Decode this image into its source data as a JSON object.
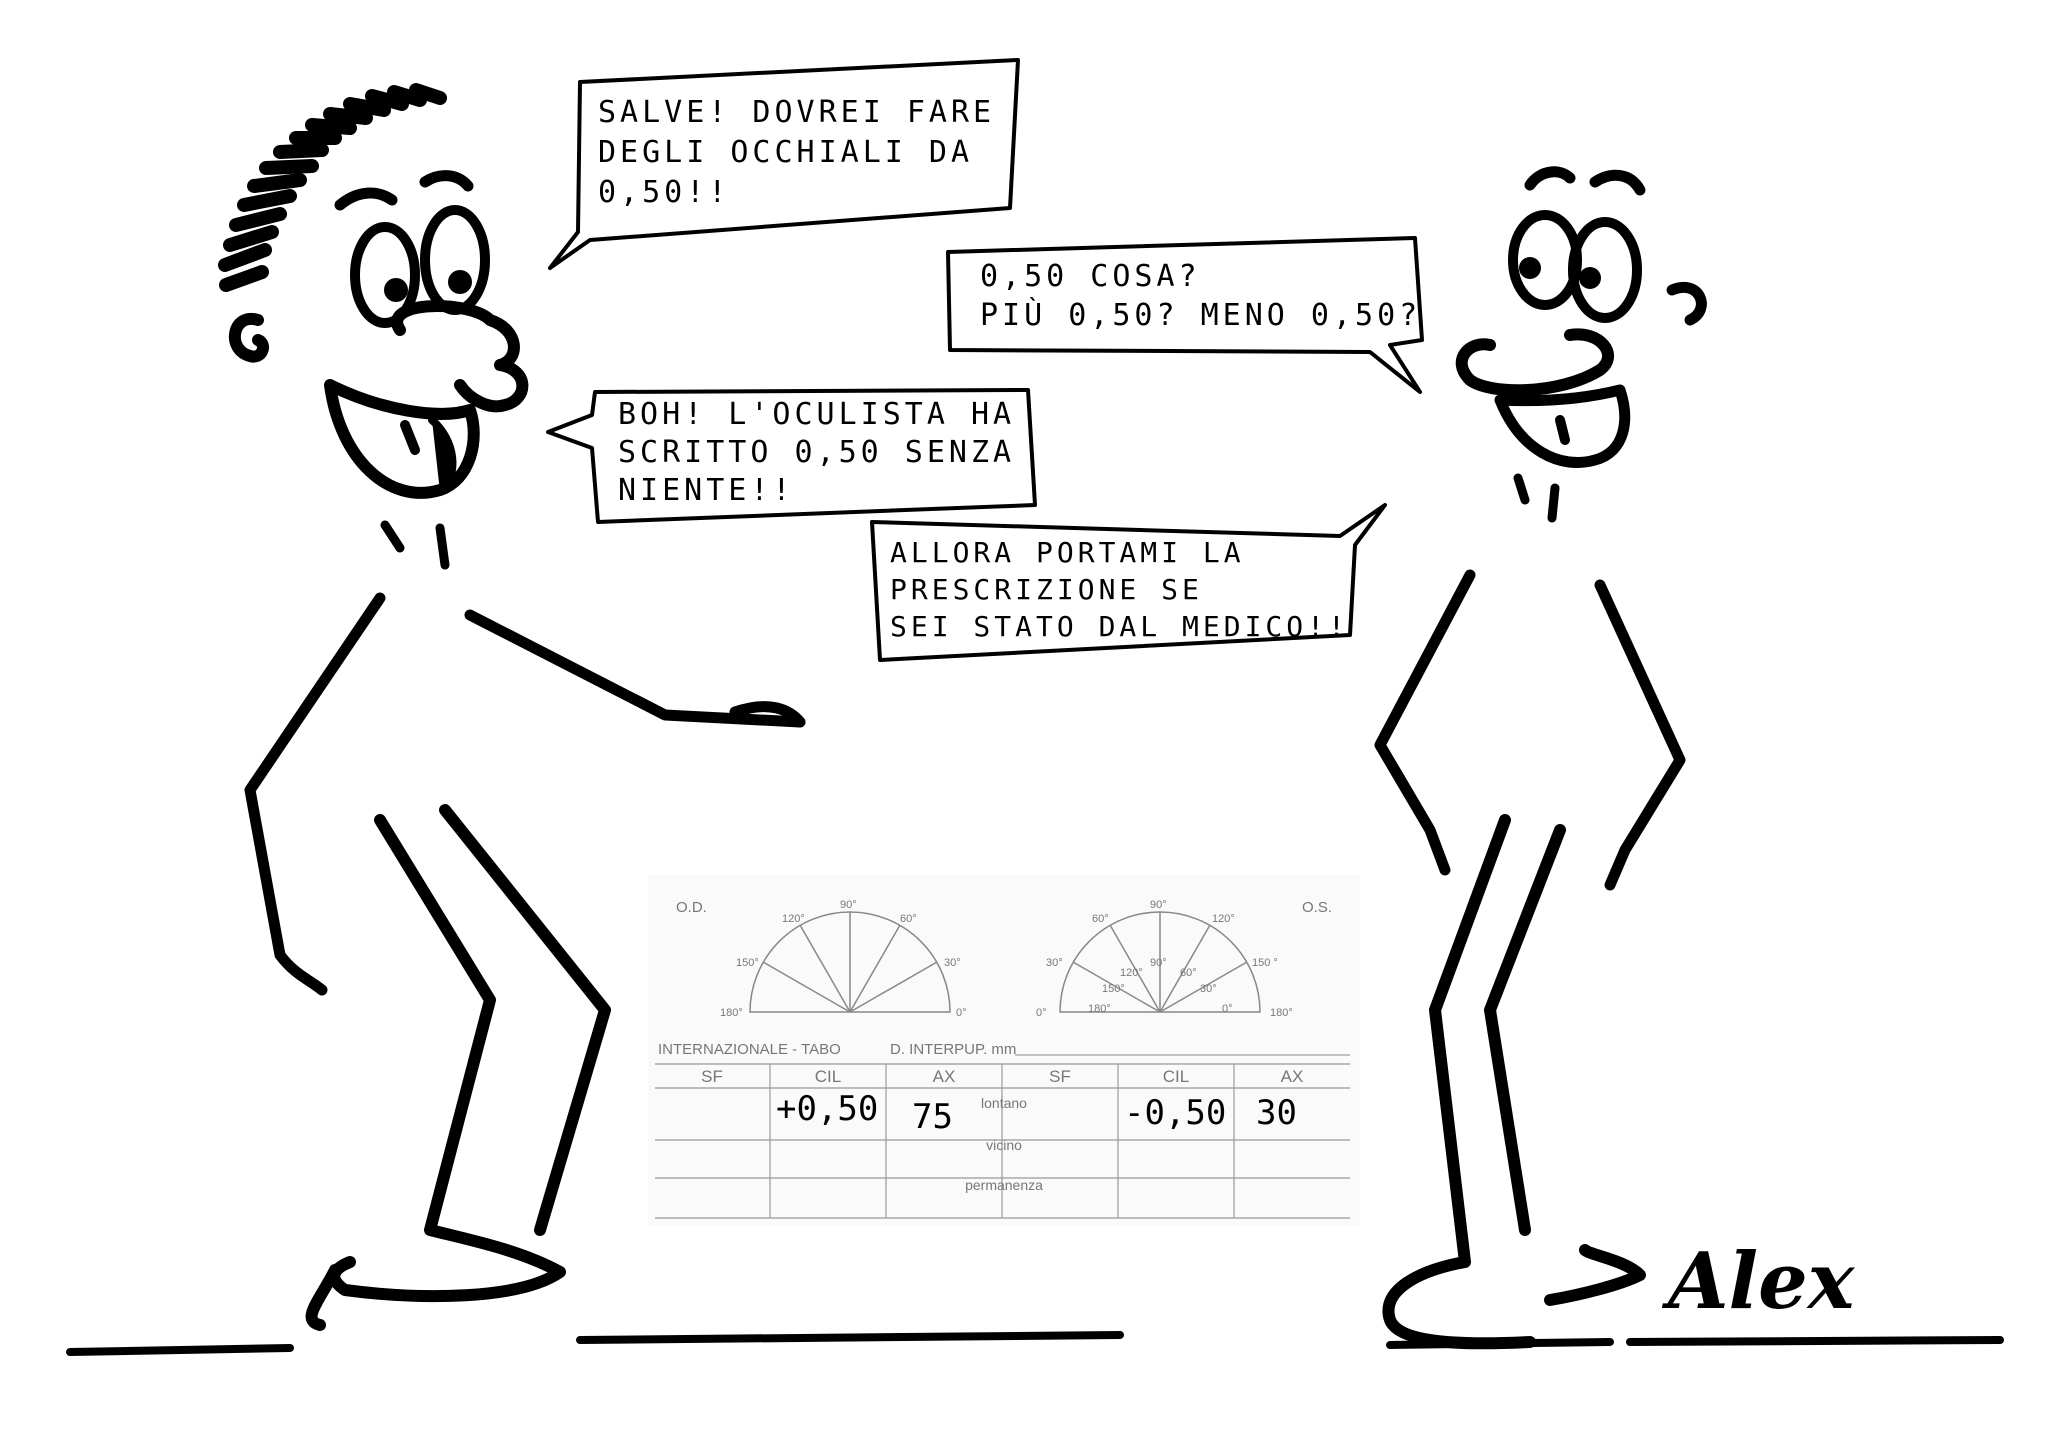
{
  "comic": {
    "bubbles": {
      "b1": {
        "line1": "SALVE! DOVREI FARE",
        "line2": "DEGLI OCCHIALI DA",
        "line3": "0,50!!"
      },
      "b2": {
        "line1": "0,50 COSA?",
        "line2": "PIÙ 0,50? MENO 0,50?"
      },
      "b3": {
        "line1": "BOH! L'OCULISTA HA",
        "line2": "SCRITTO 0,50 SENZA",
        "line3": "NIENTE!!"
      },
      "b4": {
        "line1": "ALLORA PORTAMI LA",
        "line2": "PRESCRIZIONE SE",
        "line3": "SEI STATO DAL MEDICO!!"
      }
    },
    "signature": "Alex"
  },
  "prescription": {
    "od_label": "O.D.",
    "os_label": "O.S.",
    "dial_left": {
      "ticks": [
        "120°",
        "90°",
        "60°",
        "150°",
        "30°",
        "180°",
        "0°"
      ]
    },
    "dial_right": {
      "outer_ticks": [
        "60°",
        "90°",
        "120°",
        "30°",
        "150 °",
        "0°",
        "180°"
      ],
      "inner_ticks": [
        "120°",
        "90°",
        "60°",
        "150°",
        "30°",
        "180°",
        "0°"
      ]
    },
    "system_label": "INTERNAZIONALE - TABO",
    "interpup_label": "D. INTERPUP. mm",
    "headers": [
      "SF",
      "CIL",
      "AX",
      "SF",
      "CIL",
      "AX"
    ],
    "row_labels": [
      "lontano",
      "vicino",
      "permanenza"
    ],
    "values": {
      "od_cil": "+0,50",
      "od_ax": "75",
      "os_cil": "-0,50",
      "os_ax": "30"
    }
  }
}
